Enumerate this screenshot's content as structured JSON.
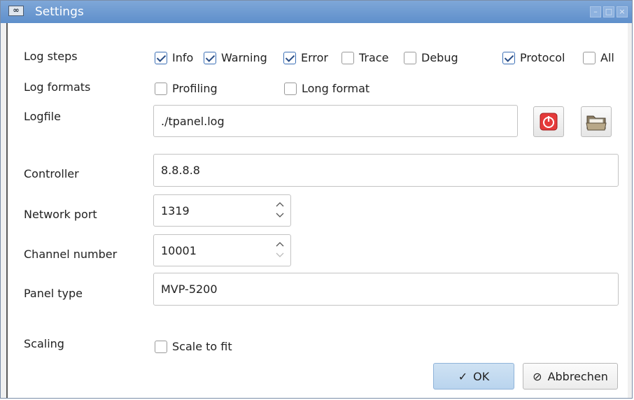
{
  "window": {
    "title": "Settings",
    "app_icon": "tpanel-app-icon",
    "controls": [
      "minimize-icon",
      "maximize-icon",
      "close-icon"
    ]
  },
  "labels": {
    "log_steps": "Log steps",
    "log_formats": "Log formats",
    "logfile": "Logfile",
    "controller": "Controller",
    "network_port": "Network port",
    "channel_number": "Channel number",
    "panel_type": "Panel type",
    "scaling": "Scaling"
  },
  "log_steps": [
    {
      "label": "Info",
      "checked": true
    },
    {
      "label": "Warning",
      "checked": true
    },
    {
      "label": "Error",
      "checked": true
    },
    {
      "label": "Trace",
      "checked": false
    },
    {
      "label": "Debug",
      "checked": false
    },
    {
      "label": "Protocol",
      "checked": true
    },
    {
      "label": "All",
      "checked": false
    }
  ],
  "log_formats": [
    {
      "label": "Profiling",
      "checked": false
    },
    {
      "label": "Long format",
      "checked": false
    }
  ],
  "fields": {
    "logfile": "./tpanel.log",
    "controller": "8.8.8.8",
    "network_port": "1319",
    "channel_number": "10001",
    "panel_type": "MVP-5200"
  },
  "scaling": {
    "label": "Scale to fit",
    "checked": false
  },
  "buttons": {
    "ok": "OK",
    "cancel": "Abbrechen",
    "reset_logfile_icon": "red-power-reset-icon",
    "open_folder_icon": "folder-open-icon"
  },
  "colors": {
    "title_bar": "#6d99d2",
    "ok_button": "#c4dbf1",
    "check_mark": "#2b4e86",
    "red_button": "#e53a3a"
  }
}
